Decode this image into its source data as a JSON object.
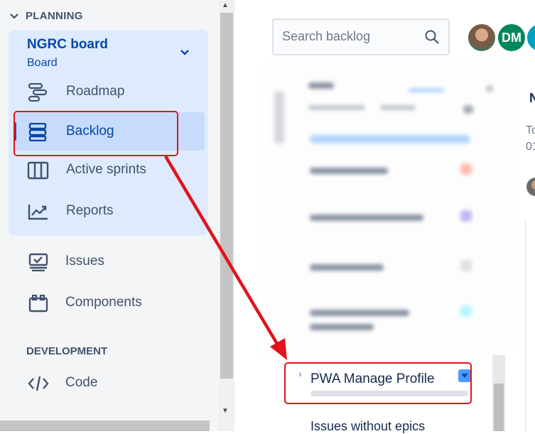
{
  "sidebar": {
    "section_planning": "PLANNING",
    "board": {
      "name": "NGRC board",
      "subtitle": "Board"
    },
    "items": [
      {
        "label": "Roadmap",
        "icon": "roadmap-icon"
      },
      {
        "label": "Backlog",
        "icon": "backlog-icon",
        "active": true
      },
      {
        "label": "Active sprints",
        "icon": "active-sprints-icon"
      },
      {
        "label": "Reports",
        "icon": "reports-icon"
      },
      {
        "label": "Issues",
        "icon": "issues-icon"
      },
      {
        "label": "Components",
        "icon": "components-icon"
      }
    ],
    "section_development": "DEVELOPMENT",
    "dev_items": [
      {
        "label": "Code",
        "icon": "code-icon"
      }
    ]
  },
  "search": {
    "placeholder": "Search backlog"
  },
  "avatars": [
    {
      "initials": ""
    },
    {
      "initials": "DM"
    },
    {
      "initials": ""
    }
  ],
  "side_panel": {
    "heading_fragment": "N",
    "text_a": "To",
    "text_b": "01"
  },
  "epics": {
    "highlighted": "PWA Manage Profile",
    "without_epics": "Issues without epics"
  },
  "colors": {
    "accent": "#0052cc",
    "highlight": "#e3121c",
    "active_bg": "#c7dcfb",
    "group_bg": "#deebff"
  }
}
